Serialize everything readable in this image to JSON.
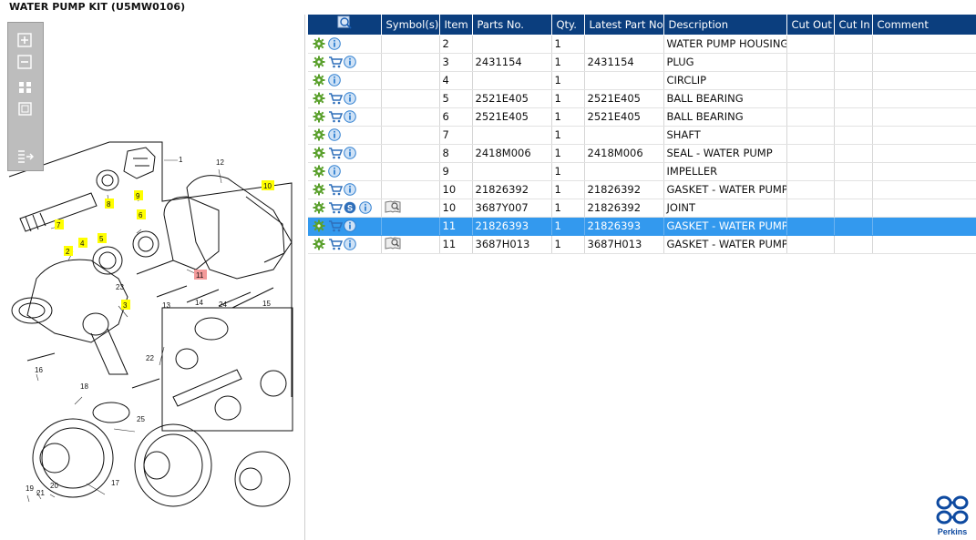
{
  "title": "WATER PUMP KIT (U5MW0106)",
  "toolbar": {
    "buttons": [
      "zoom-in",
      "zoom-out",
      "fit-page",
      "actual-size",
      "export"
    ]
  },
  "diagram": {
    "callouts": {
      "c1": "1",
      "c2": "2",
      "c3": "3",
      "c4": "4",
      "c5": "5",
      "c6": "6",
      "c7": "7",
      "c8": "8",
      "c9": "9",
      "c10": "10",
      "c11": "11",
      "c12": "12",
      "c13": "13",
      "c14": "14",
      "c15": "15",
      "c16": "16",
      "c17": "17",
      "c18": "18",
      "c19": "19",
      "c20": "20",
      "c21": "21",
      "c22": "22",
      "c23": "23",
      "c24": "24",
      "c25": "25"
    },
    "highlight_color": "#ffff00",
    "selected_color": "#f39a9a"
  },
  "grid": {
    "headers": [
      "",
      "Symbol(s)",
      "Item",
      "Parts No.",
      "Qty.",
      "Latest Part No.",
      "Description",
      "Cut Out",
      "Cut In",
      "Comment"
    ],
    "rows": [
      {
        "icons": [
          "gear-icon",
          "info-icon"
        ],
        "symbol": "",
        "item": "2",
        "parts_no": "",
        "qty": "1",
        "latest": "",
        "description": "WATER PUMP HOUSING",
        "cut_out": "",
        "cut_in": "",
        "comment": ""
      },
      {
        "icons": [
          "gear-icon",
          "cart-icon",
          "info-icon"
        ],
        "symbol": "",
        "item": "3",
        "parts_no": "2431154",
        "qty": "1",
        "latest": "2431154",
        "description": "PLUG",
        "cut_out": "",
        "cut_in": "",
        "comment": ""
      },
      {
        "icons": [
          "gear-icon",
          "info-icon"
        ],
        "symbol": "",
        "item": "4",
        "parts_no": "",
        "qty": "1",
        "latest": "",
        "description": "CIRCLIP",
        "cut_out": "",
        "cut_in": "",
        "comment": ""
      },
      {
        "icons": [
          "gear-icon",
          "cart-icon",
          "info-icon"
        ],
        "symbol": "",
        "item": "5",
        "parts_no": "2521E405",
        "qty": "1",
        "latest": "2521E405",
        "description": "BALL BEARING",
        "cut_out": "",
        "cut_in": "",
        "comment": ""
      },
      {
        "icons": [
          "gear-icon",
          "cart-icon",
          "info-icon"
        ],
        "symbol": "",
        "item": "6",
        "parts_no": "2521E405",
        "qty": "1",
        "latest": "2521E405",
        "description": "BALL BEARING",
        "cut_out": "",
        "cut_in": "",
        "comment": ""
      },
      {
        "icons": [
          "gear-icon",
          "info-icon"
        ],
        "symbol": "",
        "item": "7",
        "parts_no": "",
        "qty": "1",
        "latest": "",
        "description": "SHAFT",
        "cut_out": "",
        "cut_in": "",
        "comment": ""
      },
      {
        "icons": [
          "gear-icon",
          "cart-icon",
          "info-icon"
        ],
        "symbol": "",
        "item": "8",
        "parts_no": "2418M006",
        "qty": "1",
        "latest": "2418M006",
        "description": "SEAL - WATER PUMP",
        "cut_out": "",
        "cut_in": "",
        "comment": ""
      },
      {
        "icons": [
          "gear-icon",
          "info-icon"
        ],
        "symbol": "",
        "item": "9",
        "parts_no": "",
        "qty": "1",
        "latest": "",
        "description": "IMPELLER",
        "cut_out": "",
        "cut_in": "",
        "comment": ""
      },
      {
        "icons": [
          "gear-icon",
          "cart-icon",
          "info-icon"
        ],
        "symbol": "",
        "item": "10",
        "parts_no": "21826392",
        "qty": "1",
        "latest": "21826392",
        "description": "GASKET - WATER PUMP",
        "cut_out": "",
        "cut_in": "",
        "comment": ""
      },
      {
        "icons": [
          "gear-icon",
          "cart-icon",
          "s-badge-icon",
          "info-icon"
        ],
        "symbol": "book-search-icon",
        "item": "10",
        "parts_no": "3687Y007",
        "qty": "1",
        "latest": "21826392",
        "description": "JOINT",
        "cut_out": "",
        "cut_in": "",
        "comment": ""
      },
      {
        "icons": [
          "gear-icon",
          "cart-icon",
          "info-icon"
        ],
        "symbol": "",
        "item": "11",
        "parts_no": "21826393",
        "qty": "1",
        "latest": "21826393",
        "description": "GASKET - WATER PUMP",
        "cut_out": "",
        "cut_in": "",
        "comment": "",
        "selected": true
      },
      {
        "icons": [
          "gear-icon",
          "cart-icon",
          "info-icon"
        ],
        "symbol": "book-search-icon",
        "item": "11",
        "parts_no": "3687H013",
        "qty": "1",
        "latest": "3687H013",
        "description": "GASKET - WATER PUMP",
        "cut_out": "",
        "cut_in": "",
        "comment": ""
      }
    ]
  },
  "brand": {
    "name": "Perkins",
    "color": "#0e4aa0"
  },
  "colors": {
    "header_bg": "#0b3e7e",
    "selected_row": "#3399ee",
    "gear_green": "#5aa02c",
    "info_blue": "#2f7fd0"
  }
}
